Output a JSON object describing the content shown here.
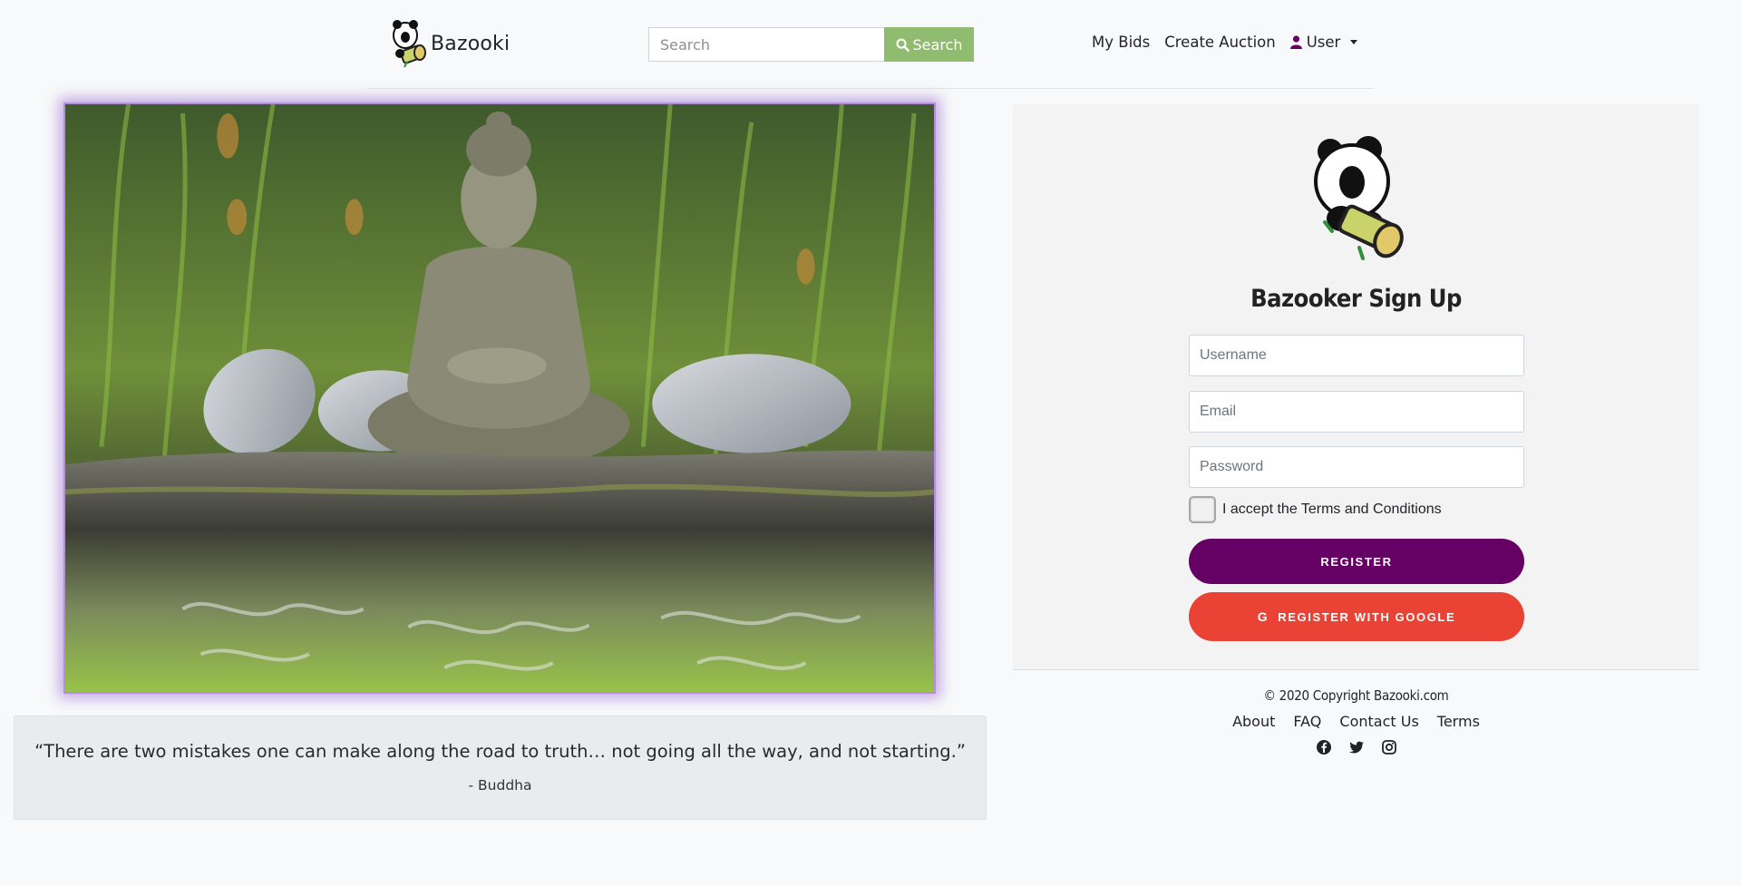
{
  "nav": {
    "brand": "Bazooki",
    "search_placeholder": "Search",
    "search_button": "Search",
    "links": [
      "My Bids",
      "Create Auction"
    ],
    "user_menu": "User"
  },
  "hero": {
    "image": "Buddha statue meditating on a rock between stones, reflected in water"
  },
  "quote": {
    "text": "“There are two mistakes one can make along the road to truth… not going all the way, and not starting.”",
    "author": "- Buddha"
  },
  "signup": {
    "title": "Bazooker Sign Up",
    "username_placeholder": "Username",
    "email_placeholder": "Email",
    "password_placeholder": "Password",
    "terms_label": "I accept the Terms and Conditions",
    "terms_checked": false,
    "register_button": "REGISTER",
    "google_button": "REGISTER WITH GOOGLE"
  },
  "footer": {
    "copyright": "© 2020 Copyright Bazooki.com",
    "links": [
      "About",
      "FAQ",
      "Contact Us",
      "Terms"
    ],
    "social_icons": [
      "facebook-icon",
      "twitter-icon",
      "instagram-icon"
    ]
  },
  "colors": {
    "brand_purple": "#650165",
    "google_red": "#ea4335",
    "search_green": "#8fbc6f",
    "hero_glow": "#b58ce0"
  }
}
